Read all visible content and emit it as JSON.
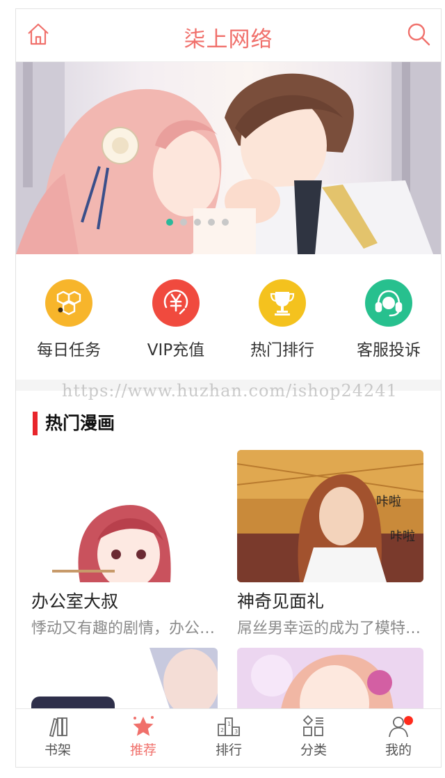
{
  "header": {
    "title": "柒上网络",
    "home_icon": "home-icon",
    "search_icon": "search-icon"
  },
  "banner": {
    "slides": 5,
    "active_slide": 1
  },
  "quick_menu": [
    {
      "label": "每日任务",
      "icon": "honeycomb-icon",
      "color": "#f7b52b"
    },
    {
      "label": "VIP充值",
      "icon": "yen-coin-icon",
      "color": "#f04a3e"
    },
    {
      "label": "热门排行",
      "icon": "trophy-icon",
      "color": "#f4c21e"
    },
    {
      "label": "客服投诉",
      "icon": "headset-icon",
      "color": "#27c08e"
    }
  ],
  "watermark": "https://www.huzhan.com/ishop24241",
  "hot_section": {
    "title": "热门漫画",
    "items": [
      {
        "name": "办公室大叔",
        "desc": "悸动又有趣的剧情，办公室大叔"
      },
      {
        "name": "神奇见面礼",
        "desc": "屌丝男幸运的成为了模特经纪人"
      },
      {
        "name": "",
        "desc": ""
      },
      {
        "name": "",
        "desc": ""
      }
    ]
  },
  "tabbar": [
    {
      "label": "书架",
      "icon": "bookshelf-icon",
      "active": false
    },
    {
      "label": "推荐",
      "icon": "star-icon",
      "active": true
    },
    {
      "label": "排行",
      "icon": "ranking-podium-icon",
      "active": false
    },
    {
      "label": "分类",
      "icon": "category-grid-icon",
      "active": false
    },
    {
      "label": "我的",
      "icon": "user-icon",
      "active": false,
      "badge": true
    }
  ],
  "colors": {
    "accent": "#f0706b",
    "section_bar": "#e8252b",
    "badge": "#ff2b1c"
  }
}
